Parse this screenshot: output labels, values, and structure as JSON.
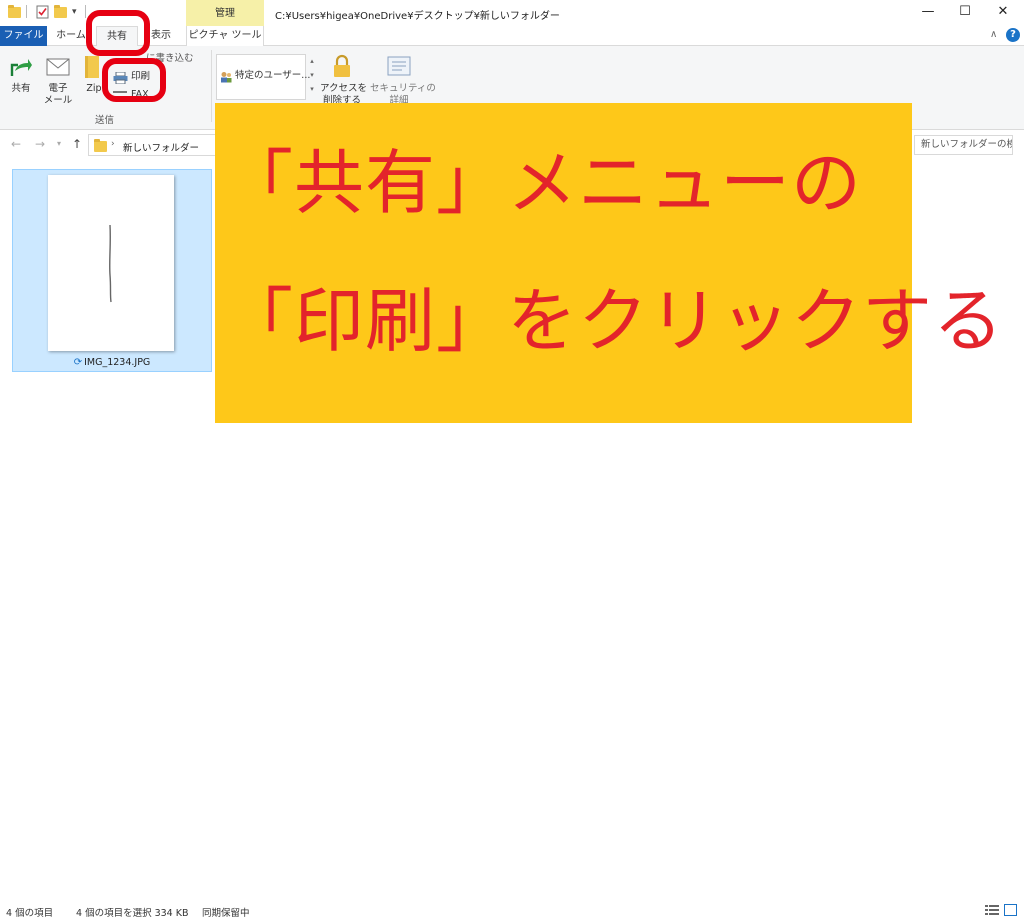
{
  "window": {
    "path": "C:¥Users¥higea¥OneDrive¥デスクトップ¥新しいフォルダー",
    "context_tab_group": "管理",
    "controls": {
      "minimize": "—",
      "maximize": "☐",
      "close": "✕"
    }
  },
  "tabs": {
    "file": "ファイル",
    "home": "ホーム",
    "share": "共有",
    "view": "表示",
    "picture_tools": "ピクチャ ツール"
  },
  "help": "?",
  "ribbon": {
    "share": "共有",
    "email": "電子\nメール",
    "zip": "Zip",
    "burn": "に書き込む",
    "print": "印刷",
    "fax": "FAX",
    "send_group": "送信",
    "specific_user": "特定のユーザー...",
    "remove_access": "アクセスを\n削除する",
    "security": "セキュリティの\n詳細"
  },
  "address": {
    "crumb": "新しいフォルダー",
    "search_placeholder": "新しいフォルダーの検..."
  },
  "files": [
    {
      "name": "IMG_1234.JPG",
      "selected": true
    }
  ],
  "callout": {
    "line1": "「共有」メニューの",
    "line2": "「印刷」をクリックする"
  },
  "status": {
    "count": "4 個の項目",
    "selected": "4 個の項目を選択  334 KB",
    "sync": "同期保留中"
  },
  "colors": {
    "file_tab": "#1a5fb4",
    "manage_tab": "#f6f0a8",
    "selection": "#cce8ff",
    "callout_bg": "#fec819",
    "callout_text": "#e3242b",
    "ring": "#e60012"
  }
}
